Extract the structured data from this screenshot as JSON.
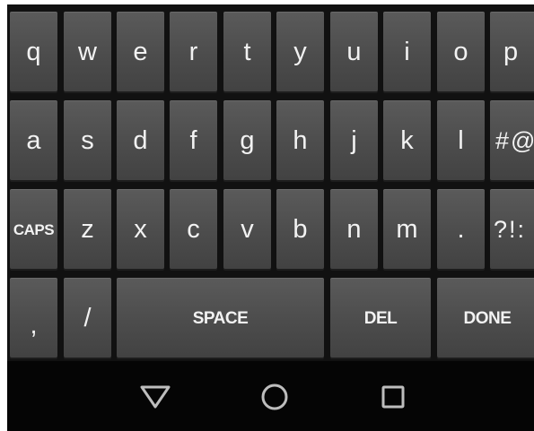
{
  "keyboard": {
    "row1": [
      "q",
      "w",
      "e",
      "r",
      "t",
      "y",
      "u",
      "i",
      "o",
      "p"
    ],
    "row2": [
      "a",
      "s",
      "d",
      "f",
      "g",
      "h",
      "j",
      "k",
      "l",
      "#@"
    ],
    "row3": [
      "CAPS",
      "z",
      "x",
      "c",
      "v",
      "b",
      "n",
      "m",
      ".",
      "?!:"
    ],
    "row4": {
      "comma": ",",
      "slash": "/",
      "space": "SPACE",
      "delete": "DEL",
      "done": "DONE"
    }
  },
  "navbar": {
    "back_icon": "triangle-back-icon",
    "home_icon": "circle-home-icon",
    "recents_icon": "square-recents-icon"
  },
  "colors": {
    "key_face": "#4c4c4c",
    "key_text": "#f2f2f2",
    "keyboard_bg": "#111111",
    "navbar_bg": "#050505",
    "nav_icon": "#bdbdbd"
  }
}
